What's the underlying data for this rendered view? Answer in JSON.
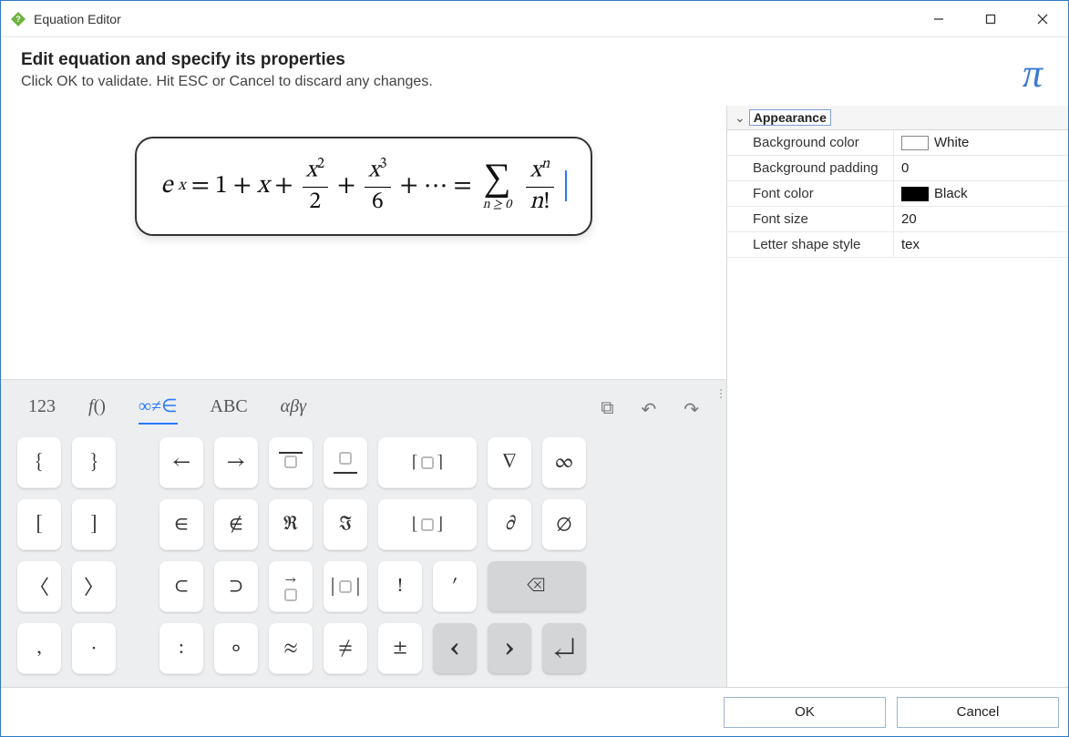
{
  "titlebar": {
    "title": "Equation Editor"
  },
  "prompt": {
    "heading": "Edit equation and specify its properties",
    "sub": "Click OK to validate. Hit ESC or Cancel to discard any changes.",
    "pi": "π"
  },
  "equation": {
    "latex": "e^x = 1 + x + \\frac{x^2}{2} + \\frac{x^3}{6} + \\cdots = \\sum_{n\\ge 0} \\frac{x^n}{n!}",
    "tokens": {
      "e": "e",
      "x": "x",
      "eq": "=",
      "one": "1",
      "plus": "+",
      "two": "2",
      "three": "3",
      "six": "6",
      "dots": "⋯",
      "n": "n",
      "ge0": "n ≥ 0",
      "bang": "!",
      "sigma": "∑"
    }
  },
  "properties": {
    "section": "Appearance",
    "rows": [
      {
        "label": "Background color",
        "value": "White",
        "color": "#ffffff",
        "border": "#888888"
      },
      {
        "label": "Background padding",
        "value": "0"
      },
      {
        "label": "Font color",
        "value": "Black",
        "color": "#000000",
        "border": "#000000"
      },
      {
        "label": "Font size",
        "value": "20"
      },
      {
        "label": "Letter shape style",
        "value": "tex"
      }
    ]
  },
  "keyboard": {
    "tabs": {
      "numbers": "123",
      "functions_f": "f",
      "functions_p": "()",
      "symbols": "∞≠∈",
      "latin": "ABC",
      "greek": "αβγ"
    },
    "tools": {
      "copy": "⧉",
      "undo": "↶",
      "redo": "↷"
    },
    "keys": {
      "lbrace": "{",
      "rbrace": "}",
      "left": "←",
      "right": "→",
      "over_nothing": " ",
      "under_nothing": " ",
      "ceil_l": "⌈",
      "ceil_r": "⌉",
      "nabla": "∇",
      "infty": "∞",
      "lbrack": "[",
      "rbrack": "]",
      "in": "∈",
      "notin": "∉",
      "Re": "ℜ",
      "Im": "ℑ",
      "floor_l": "⌊",
      "floor_r": "⌋",
      "partial": "∂",
      "emptyset": "∅",
      "langle": "〈",
      "rangle": "〉",
      "subset": "⊂",
      "supset": "⊃",
      "vec": " ",
      "abs_l": "|",
      "abs_r": "|",
      "excl": "!",
      "prime": "′",
      "backspace": "⌫",
      "comma": ",",
      "cdot": "·",
      "colon": ":",
      "circ": "∘",
      "approx": "≈",
      "neq": "≠",
      "pm": "±",
      "prev": "‹",
      "next": "›",
      "enter": "↵"
    }
  },
  "footer": {
    "ok": "OK",
    "cancel": "Cancel"
  }
}
